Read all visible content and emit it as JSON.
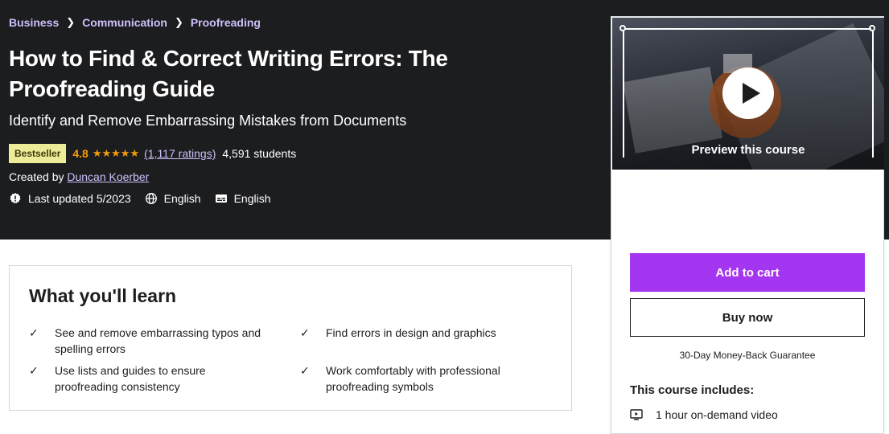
{
  "breadcrumb": [
    "Business",
    "Communication",
    "Proofreading"
  ],
  "course": {
    "title": "How to Find & Correct Writing Errors: The Proofreading Guide",
    "subtitle": "Identify and Remove Embarrassing Mistakes from Documents",
    "badge": "Bestseller",
    "rating": "4.8",
    "stars": "★★★★★",
    "ratings_count": "(1,117 ratings)",
    "students": "4,591 students",
    "created_by_label": "Created by",
    "author": "Duncan Koerber",
    "last_updated": "Last updated 5/2023",
    "language": "English",
    "captions": "English"
  },
  "preview": {
    "label": "Preview this course"
  },
  "purchase": {
    "add_to_cart": "Add to cart",
    "buy_now": "Buy now",
    "guarantee": "30-Day Money-Back Guarantee",
    "includes_title": "This course includes:",
    "includes": [
      "1 hour on-demand video"
    ]
  },
  "learn": {
    "title": "What you'll learn",
    "items": [
      "See and remove embarrassing typos and spelling errors",
      "Find errors in design and graphics",
      "Use lists and guides to ensure proofreading consistency",
      "Work comfortably with professional proofreading symbols"
    ]
  },
  "icons": {
    "chevron": "chevron-right-icon",
    "updated": "alert-badge-icon",
    "language": "globe-icon",
    "captions": "closed-captions-icon",
    "check": "check-icon",
    "video": "video-icon",
    "play": "play-icon"
  },
  "colors": {
    "hero_bg": "#1c1d1f",
    "accent_purple": "#a435f0",
    "link_lavender": "#cec0fc",
    "star_orange": "#f69c08",
    "badge_yellow": "#eceb98"
  }
}
